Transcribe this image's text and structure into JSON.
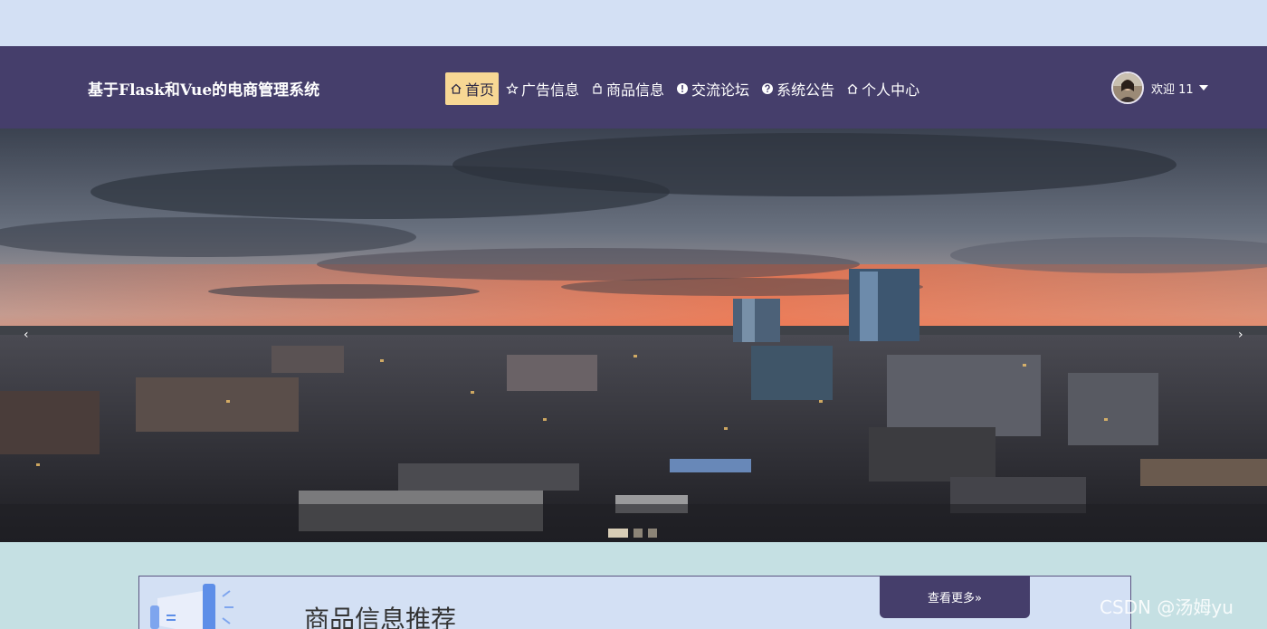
{
  "header": {
    "title": "基于Flask和Vue的电商管理系统",
    "nav": [
      {
        "label": "首页",
        "icon": "home-icon",
        "active": true
      },
      {
        "label": "广告信息",
        "icon": "star-icon",
        "active": false
      },
      {
        "label": "商品信息",
        "icon": "bag-icon",
        "active": false
      },
      {
        "label": "交流论坛",
        "icon": "info-icon",
        "active": false
      },
      {
        "label": "系统公告",
        "icon": "question-icon",
        "active": false
      },
      {
        "label": "个人中心",
        "icon": "home-icon",
        "active": false
      }
    ],
    "user": {
      "greeting": "欢迎 11"
    }
  },
  "banner": {
    "prev_label": "‹",
    "next_label": "›",
    "slide_count": 3,
    "active_slide": 1
  },
  "section": {
    "title": "商品信息推荐",
    "more_label": "查看更多»"
  },
  "watermark": "CSDN @汤姆yu",
  "colors": {
    "navbar": "#453e6b",
    "active_nav": "#f7d794",
    "page_bg": "#c5e0e3",
    "top_strip": "#d3e0f4"
  }
}
